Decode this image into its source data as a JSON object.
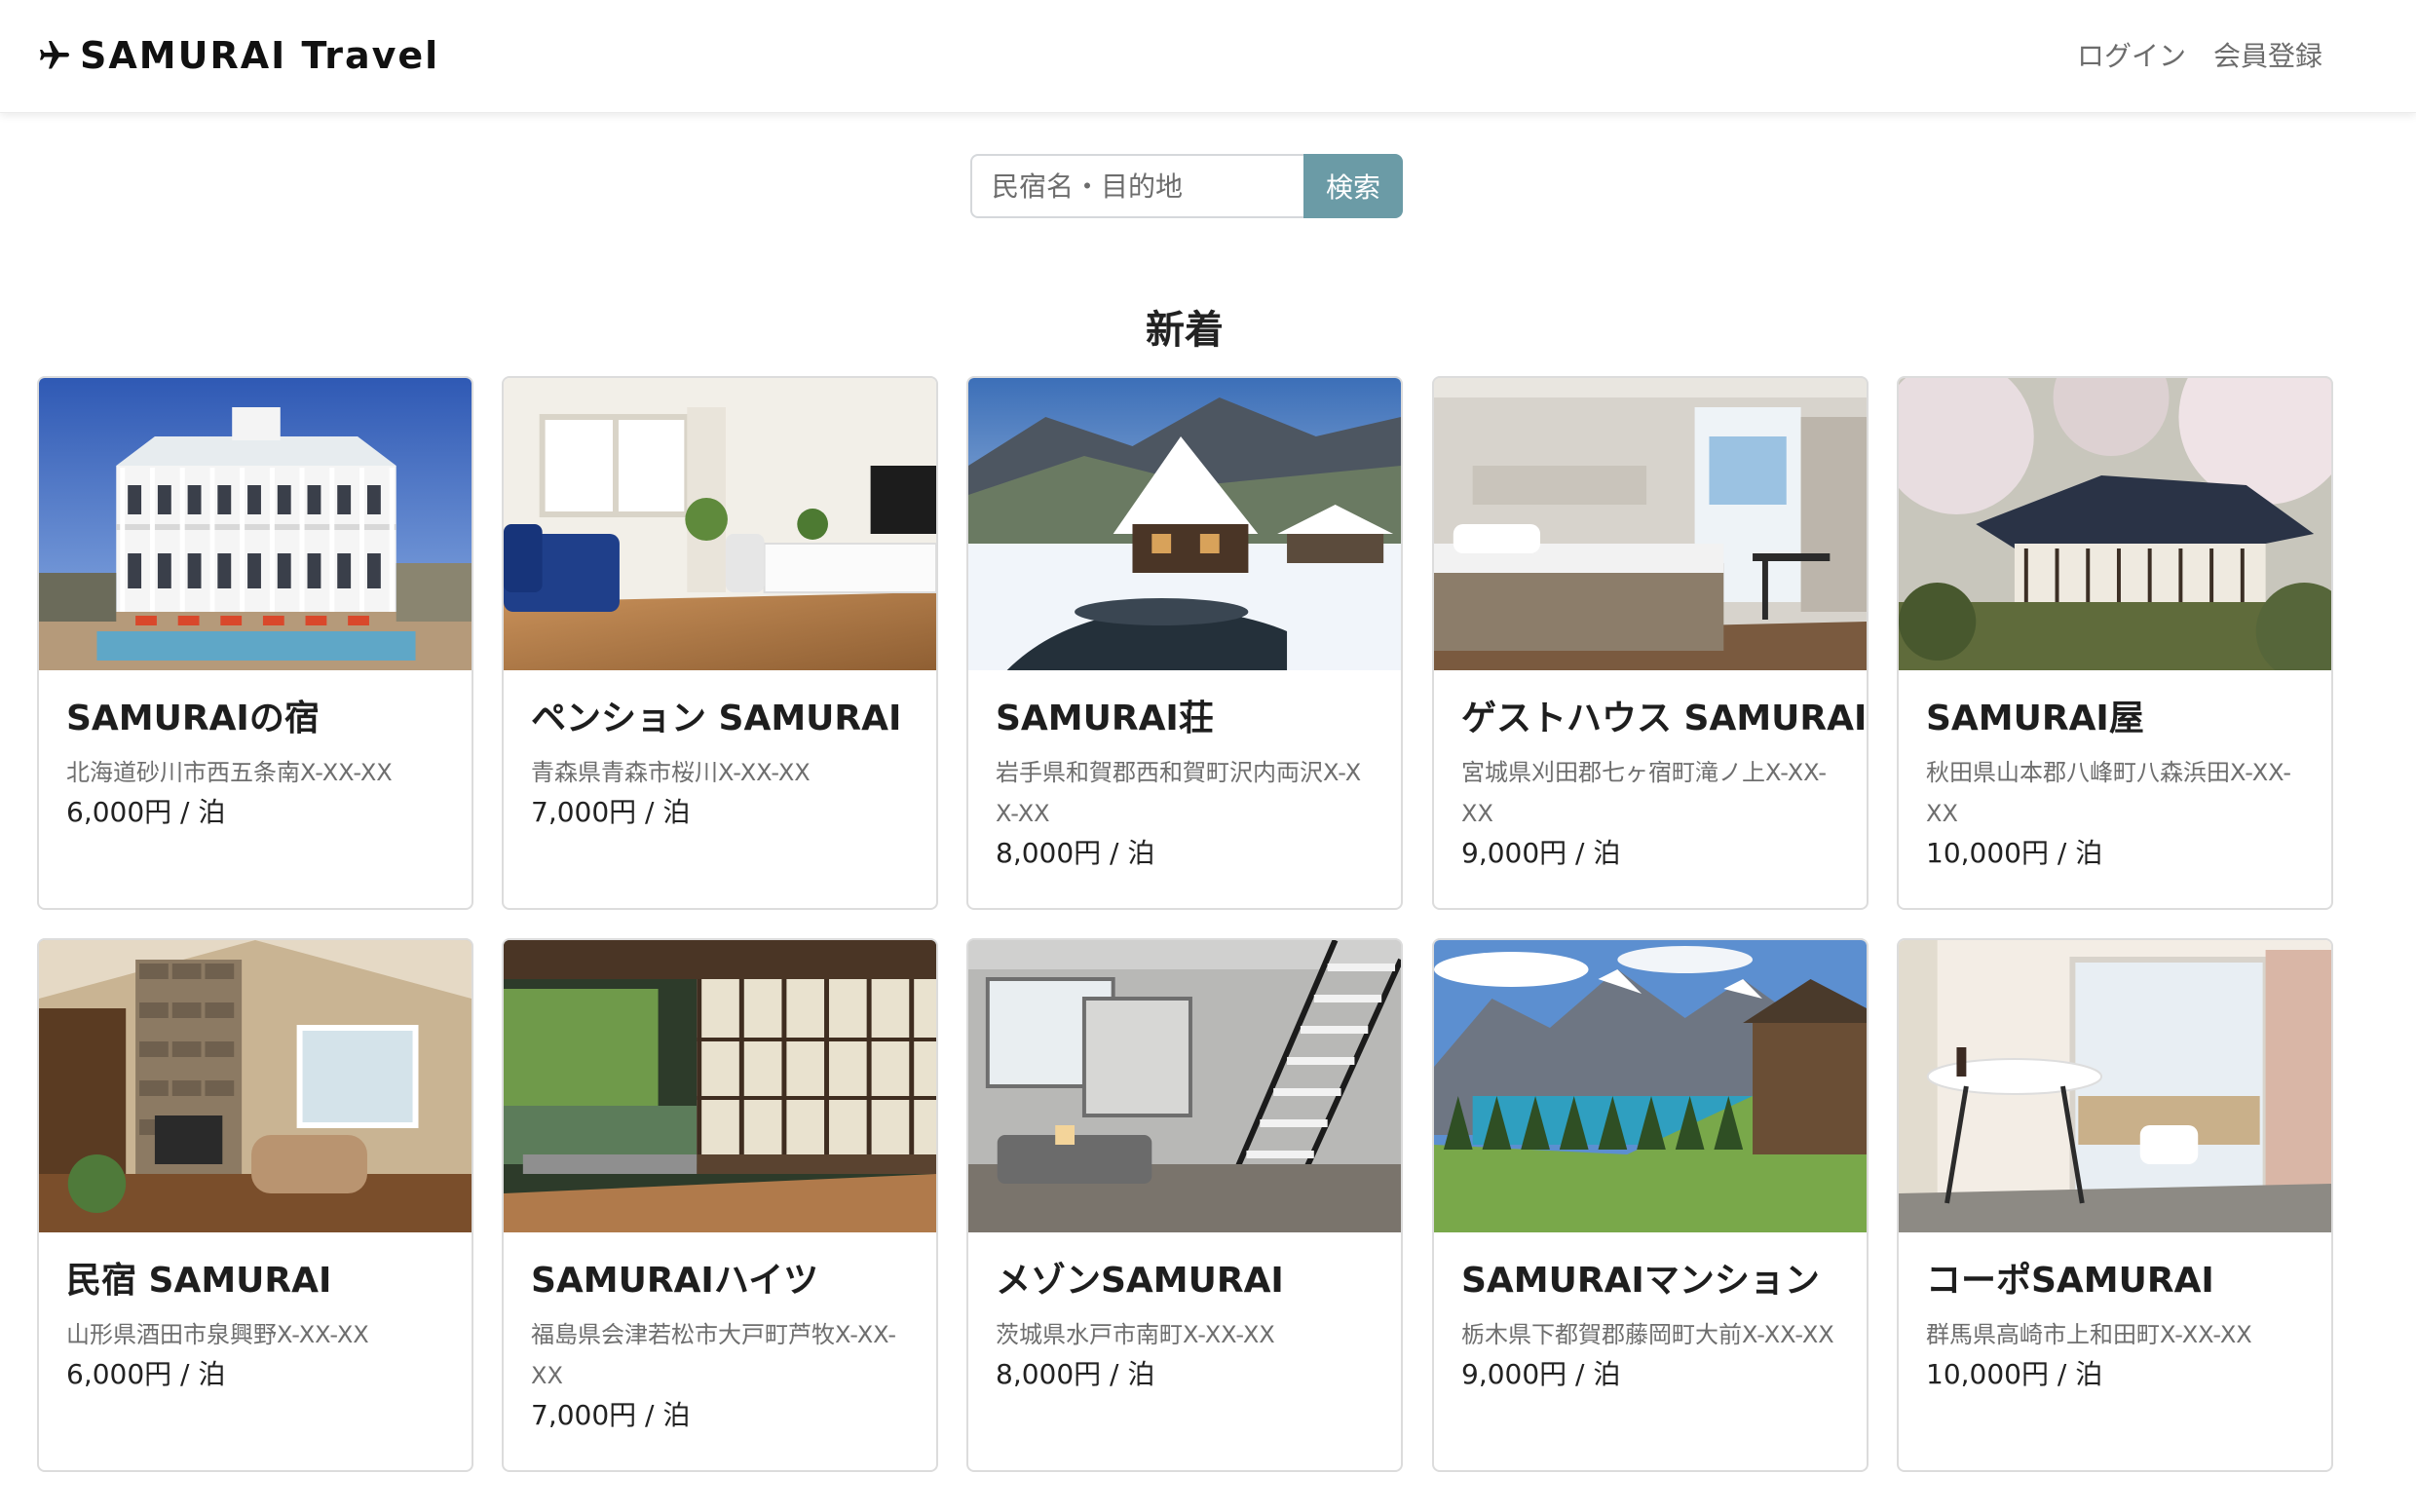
{
  "header": {
    "brand": "SAMURAI Travel",
    "login": "ログイン",
    "register": "会員登録"
  },
  "search": {
    "placeholder": "民宿名・目的地",
    "button": "検索"
  },
  "section": {
    "title": "新着"
  },
  "cards": [
    {
      "name": "SAMURAIの宿",
      "address": "北海道砂川市西五条南X-XX-XX",
      "price": "6,000円 / 泊"
    },
    {
      "name": "ペンション SAMURAI",
      "address": "青森県青森市桜川X-XX-XX",
      "price": "7,000円 / 泊"
    },
    {
      "name": "SAMURAI荘",
      "address": "岩手県和賀郡西和賀町沢内両沢X-XX-XX",
      "price": "8,000円 / 泊"
    },
    {
      "name": "ゲストハウス SAMURAI",
      "address": "宮城県刈田郡七ヶ宿町滝ノ上X-XX-XX",
      "price": "9,000円 / 泊"
    },
    {
      "name": "SAMURAI屋",
      "address": "秋田県山本郡八峰町八森浜田X-XX-XX",
      "price": "10,000円 / 泊"
    },
    {
      "name": "民宿 SAMURAI",
      "address": "山形県酒田市泉興野X-XX-XX",
      "price": "6,000円 / 泊"
    },
    {
      "name": "SAMURAIハイツ",
      "address": "福島県会津若松市大戸町芦牧X-XX-XX",
      "price": "7,000円 / 泊"
    },
    {
      "name": "メゾンSAMURAI",
      "address": "茨城県水戸市南町X-XX-XX",
      "price": "8,000円 / 泊"
    },
    {
      "name": "SAMURAIマンション",
      "address": "栃木県下都賀郡藤岡町大前X-XX-XX",
      "price": "9,000円 / 泊"
    },
    {
      "name": "コーポSAMURAI",
      "address": "群馬県高崎市上和田町X-XX-XX",
      "price": "10,000円 / 泊"
    }
  ],
  "colors": {
    "accent": "#6b9ba6",
    "card_border": "#dcdcdc"
  },
  "icons": {
    "brand": "airplane-icon"
  }
}
